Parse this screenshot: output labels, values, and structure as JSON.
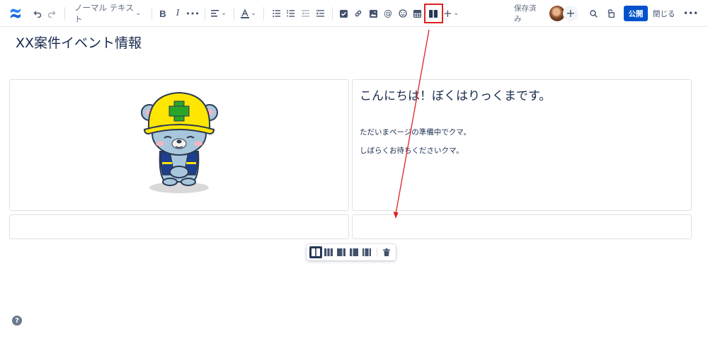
{
  "toolbar": {
    "text_style": "ノーマル テキスト",
    "saved_status": "保存済み",
    "publish_label": "公開",
    "close_label": "閉じる",
    "more_label": "•••"
  },
  "page": {
    "title": "XX案件イベント情報"
  },
  "layout": {
    "heading": "こんにちは！ぼくはりっくまです。",
    "paragraphs": [
      "ただいまページの準備中でクマ。",
      "しばらくお待ちくださいクマ。"
    ]
  },
  "colors": {
    "accent": "#0052cc",
    "annotation": "#e02020",
    "text": "#172b4d"
  },
  "icons": [
    "confluence-logo-icon",
    "undo-icon",
    "redo-icon",
    "align-icon",
    "text-color-icon",
    "bullet-list-icon",
    "numbered-list-icon",
    "outdent-icon",
    "indent-icon",
    "task-icon",
    "link-icon",
    "image-icon",
    "mention-icon",
    "emoji-icon",
    "table-icon",
    "layout-icon",
    "insert-plus-icon",
    "search-icon",
    "restrictions-icon",
    "help-icon",
    "delete-icon"
  ]
}
